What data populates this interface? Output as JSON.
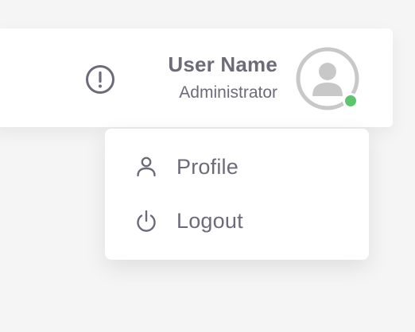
{
  "header": {
    "notice_icon": "alert-circle-icon",
    "user": {
      "name": "User Name",
      "role": "Administrator",
      "avatar_icon": "user-avatar-icon",
      "status": "online",
      "status_color": "#5fc46f"
    }
  },
  "dropdown": {
    "items": [
      {
        "label": "Profile",
        "icon": "user-icon"
      },
      {
        "label": "Logout",
        "icon": "power-icon"
      }
    ]
  },
  "colors": {
    "text": "#6d6b7a",
    "avatar_gray": "#c8c8c8",
    "background": "#f5f5f6",
    "card": "#ffffff"
  }
}
